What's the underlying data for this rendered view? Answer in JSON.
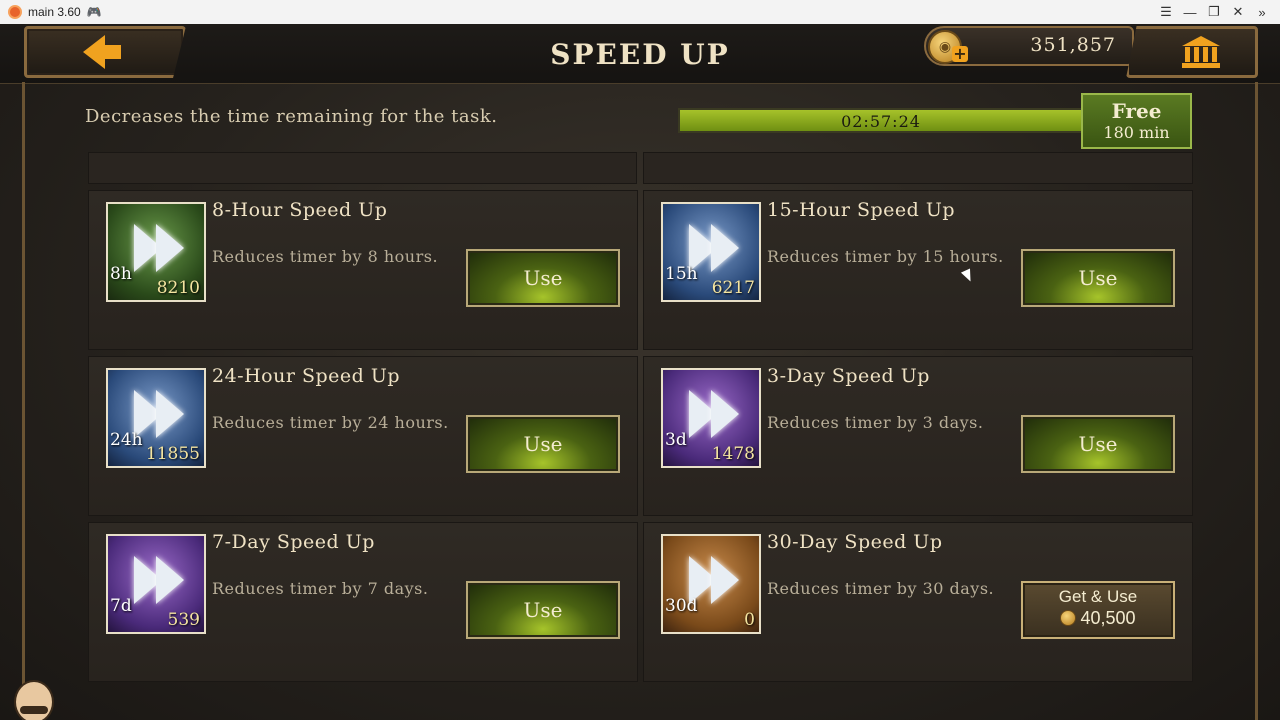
{
  "window": {
    "title": "main 3.60",
    "controls": [
      "menu-icon",
      "minimize-icon",
      "restore-icon",
      "close-icon",
      "expand-icon"
    ]
  },
  "header": {
    "title": "SPEED UP",
    "gold_amount": "351,857"
  },
  "subtitle": "Decreases the time remaining for the task.",
  "timer": {
    "value": "02:57:24",
    "free_label": "Free",
    "free_minutes": "180 min"
  },
  "items": [
    {
      "duration": "8h",
      "count": "8210",
      "name": "8-Hour Speed Up",
      "desc": "Reduces timer by 8 hours.",
      "action": "Use",
      "tint": "green"
    },
    {
      "duration": "15h",
      "count": "6217",
      "name": "15-Hour Speed Up",
      "desc": "Reduces timer by 15 hours.",
      "action": "Use",
      "tint": "blue"
    },
    {
      "duration": "24h",
      "count": "11855",
      "name": "24-Hour Speed Up",
      "desc": "Reduces timer by 24 hours.",
      "action": "Use",
      "tint": "blue"
    },
    {
      "duration": "3d",
      "count": "1478",
      "name": "3-Day Speed Up",
      "desc": "Reduces timer by 3 days.",
      "action": "Use",
      "tint": "purple"
    },
    {
      "duration": "7d",
      "count": "539",
      "name": "7-Day Speed Up",
      "desc": "Reduces timer by 7 days.",
      "action": "Use",
      "tint": "purple"
    },
    {
      "duration": "30d",
      "count": "0",
      "name": "30-Day Speed Up",
      "desc": "Reduces timer by 30 days.",
      "action": "Get & Use",
      "price": "40,500",
      "tint": "orange"
    }
  ],
  "colors": {
    "accent_gold": "#f0a21f",
    "progress_green": "#a6c22a",
    "frame_bronze": "#8a6a3e"
  }
}
